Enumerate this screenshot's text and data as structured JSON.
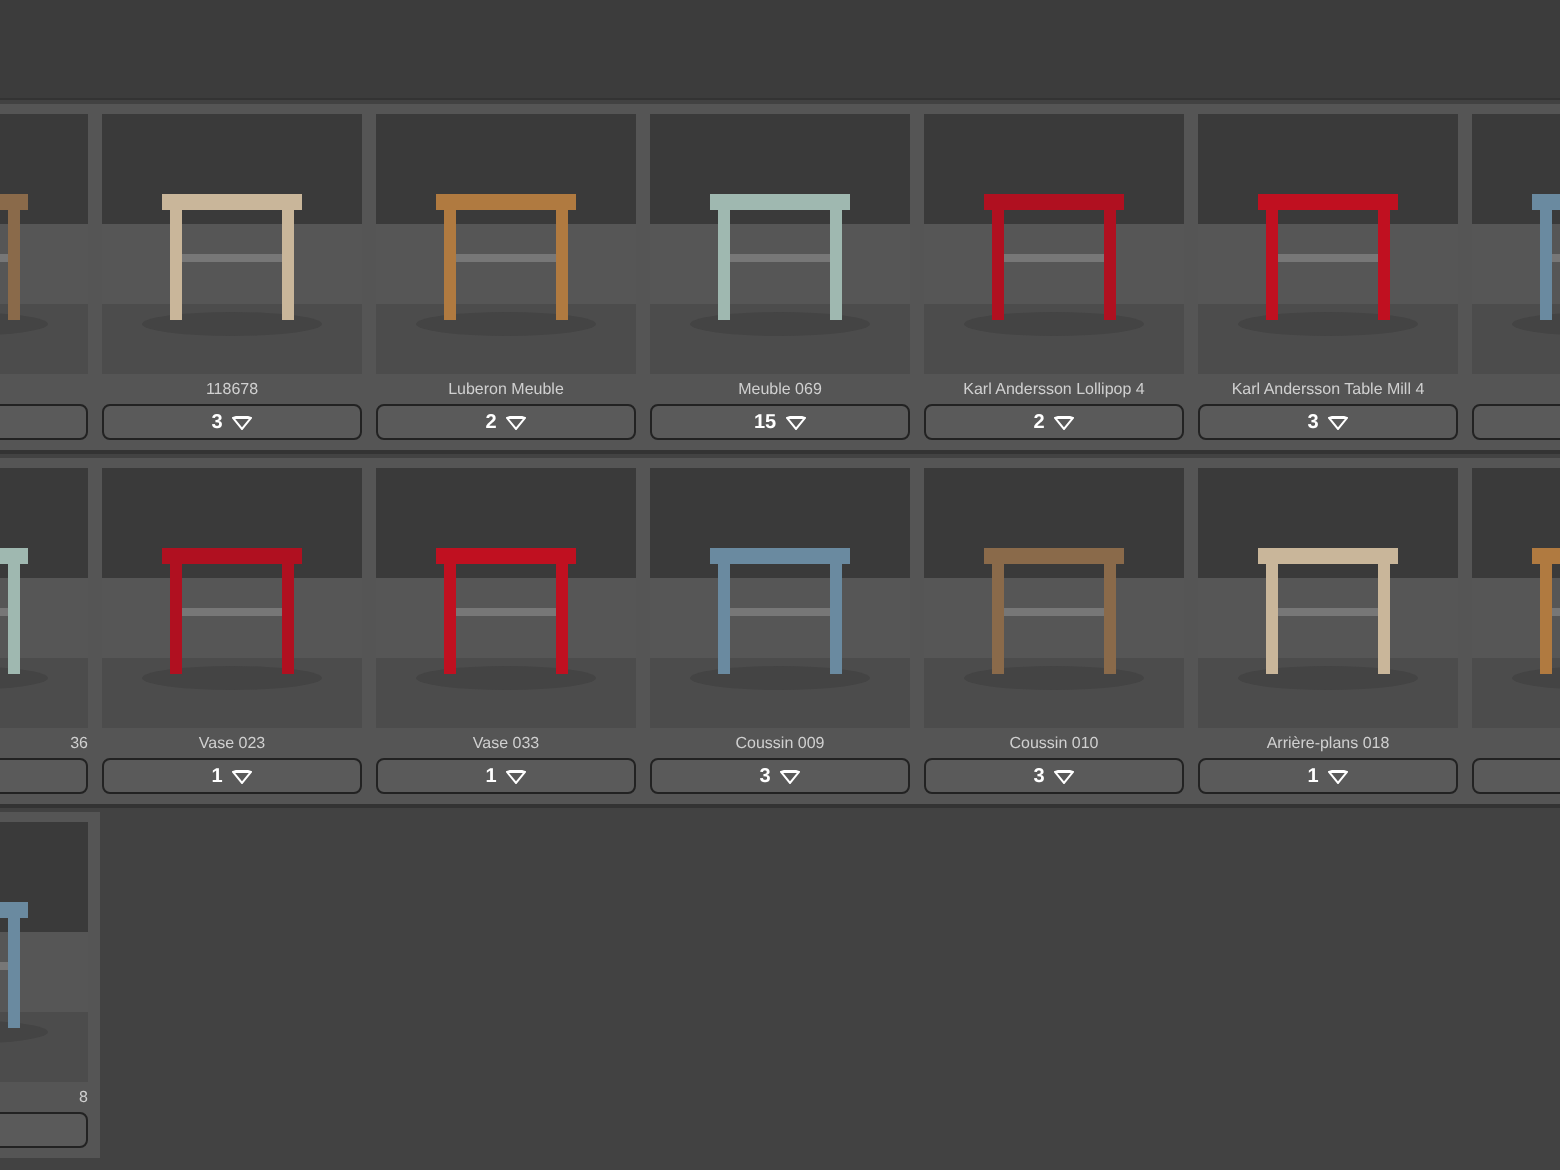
{
  "rows": [
    {
      "tiles": [
        {
          "image": {
            "kind": "picture"
          }
        },
        {
          "image": {
            "kind": "picture"
          },
          "label": "118678",
          "count": "3"
        },
        {
          "image": {
            "kind": "picture"
          },
          "label": "Luberon Meuble",
          "count": "2"
        },
        {
          "image": {
            "kind": "picture"
          },
          "label": "Meuble 069",
          "count": "15"
        },
        {
          "image": {
            "kind": "picture"
          },
          "label": "Karl Andersson Lollipop 4",
          "count": "2"
        },
        {
          "image": {
            "kind": "picture"
          },
          "label": "Karl Andersson Table Mill 4",
          "count": "3"
        },
        {
          "image": {
            "kind": "picture"
          }
        }
      ]
    },
    {
      "tiles": [
        {
          "image": {
            "kind": "picture"
          },
          "label": "36"
        },
        {
          "image": {
            "kind": "picture"
          },
          "label": "Vase 023",
          "count": "1"
        },
        {
          "image": {
            "kind": "picture"
          },
          "label": "Vase 033",
          "count": "1"
        },
        {
          "image": {
            "kind": "picture"
          },
          "label": "Coussin 009",
          "count": "3"
        },
        {
          "image": {
            "kind": "picture"
          },
          "label": "Coussin 010",
          "count": "3"
        },
        {
          "image": {
            "kind": "picture"
          },
          "label": "Arrière-plans 018",
          "count": "1"
        },
        {
          "image": {
            "kind": "picture"
          }
        }
      ]
    },
    {
      "tiles": [
        {
          "image": {
            "kind": "picture"
          },
          "label": "8"
        }
      ]
    }
  ]
}
